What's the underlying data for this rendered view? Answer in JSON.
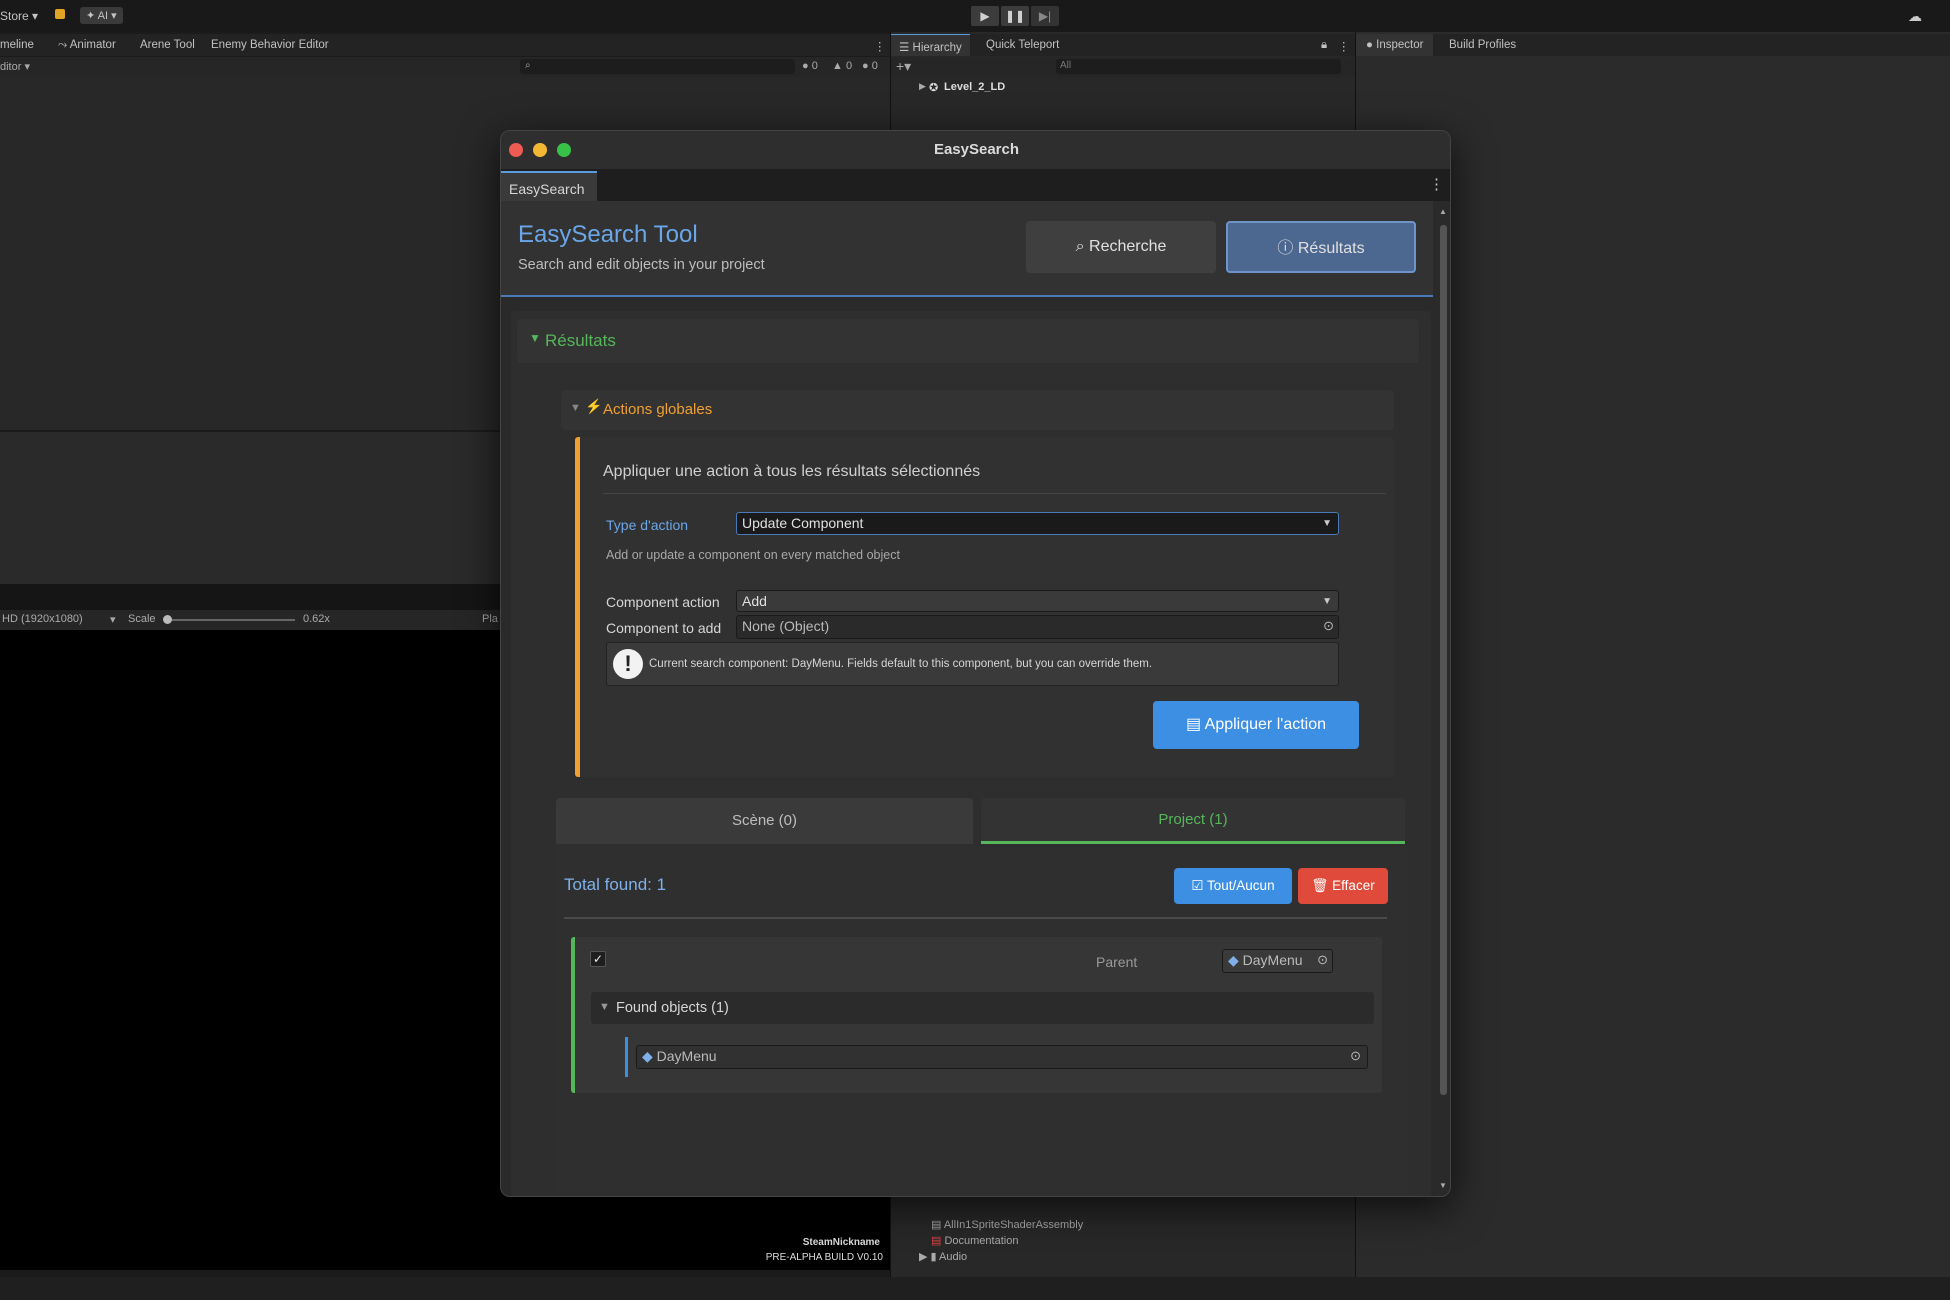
{
  "topbar": {
    "store_label": "Store ▾",
    "ai_label": "✦ AI ▾",
    "play_icon": "play-icon",
    "pause_icon": "pause-icon",
    "step_icon": "step-icon"
  },
  "left_tabs": [
    "meline",
    "Animator",
    "Arene Tool",
    "Enemy Behavior Editor"
  ],
  "left_toolbar": {
    "editor_dropdown": "ditor ▾",
    "counts": {
      "errors": "0",
      "warnings": "0",
      "infos": "0"
    }
  },
  "hierarchy": {
    "tabs": [
      "Hierarchy",
      "Quick Teleport"
    ],
    "search_placeholder": "All",
    "scene_name": "Level_2_LD"
  },
  "inspector_tabs": [
    "Inspector",
    "Build Profiles"
  ],
  "game_view": {
    "resolution": "HD (1920x1080)",
    "scale_label": "Scale",
    "scale_value": "0.62x",
    "play_label": "Pla",
    "overlay_name": "SteamNickname",
    "build_label": "PRE-ALPHA BUILD V0.10"
  },
  "project_panel": {
    "items": [
      "AllIn1SpriteShaderAssembly",
      "Documentation",
      "Audio"
    ]
  },
  "window": {
    "title": "EasySearch",
    "tab": "EasySearch",
    "app_name": "EasySearch Tool",
    "app_subtitle": "Search and edit objects in your project",
    "btn_search": "Recherche",
    "btn_results": "Résultats",
    "results_section": "Résultats",
    "global_actions": "Actions globales",
    "apply_desc": "Appliquer une action à tous les résultats sélectionnés",
    "type_label": "Type d'action",
    "type_value": "Update Component",
    "type_help": "Add or update a component on every matched object",
    "comp_action_label": "Component action",
    "comp_action_value": "Add",
    "comp_add_label": "Component to add",
    "comp_add_value": "None (Object)",
    "info_text": "Current search component: DayMenu. Fields default to this component, but you can override them.",
    "apply_btn": "Appliquer l'action",
    "tab_scene": "Scène (0)",
    "tab_project": "Project (1)",
    "total_found": "Total found: 1",
    "btn_all_none": "Tout/Aucun",
    "btn_clear": "Effacer",
    "parent_label": "Parent",
    "parent_value": "DayMenu",
    "found_objects": "Found objects (1)",
    "found_item": "DayMenu"
  },
  "colors": {
    "accent_blue": "#5a9be0",
    "accent_green": "#56b65a",
    "accent_orange": "#f0a030",
    "danger": "#e04a3a",
    "primary_button": "#3d8fe3"
  }
}
